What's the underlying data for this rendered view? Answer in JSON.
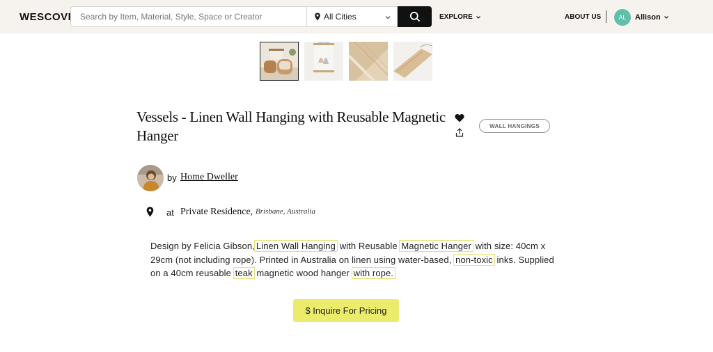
{
  "header": {
    "logo": "WESCOVER",
    "search_placeholder": "Search by Item, Material, Style, Space or Creator",
    "city_select": "All Cities",
    "explore": "EXPLORE",
    "about": "ABOUT US",
    "avatar_initials": "AL",
    "user_name": "Allison"
  },
  "product": {
    "title": "Vessels - Linen Wall Hanging with Reusable Magnetic Hanger",
    "tag": "WALL HANGINGS",
    "by_label": "by",
    "creator": "Home Dweller",
    "at_label": "at",
    "place": "Private Residence,",
    "city": "Brisbane, Australia",
    "description": {
      "p1": "Design by Felicia Gibson,",
      "k1": "Linen Wall Hanging",
      "p2": "with Reusable",
      "k2": "Magnetic Hanger",
      "p3": "with size: 40cm x 29cm (not including rope). Printed in Australia on linen using water-based,",
      "k3": "non-toxic",
      "p4": "inks. Supplied on a 40cm reusable",
      "k4": "teak",
      "p5": "magnetic wood hanger",
      "k5": "with rope."
    },
    "cta": "$ Inquire For Pricing"
  },
  "colors": {
    "header_bg": "#f6f3ef",
    "avatar_bg": "#5fbfa8",
    "cta_bg": "#ecec6c",
    "highlight": "#e6e274"
  },
  "icons": [
    "search-icon",
    "pin-icon",
    "chevron-down-icon",
    "heart-icon",
    "share-icon",
    "location-pin-icon"
  ]
}
